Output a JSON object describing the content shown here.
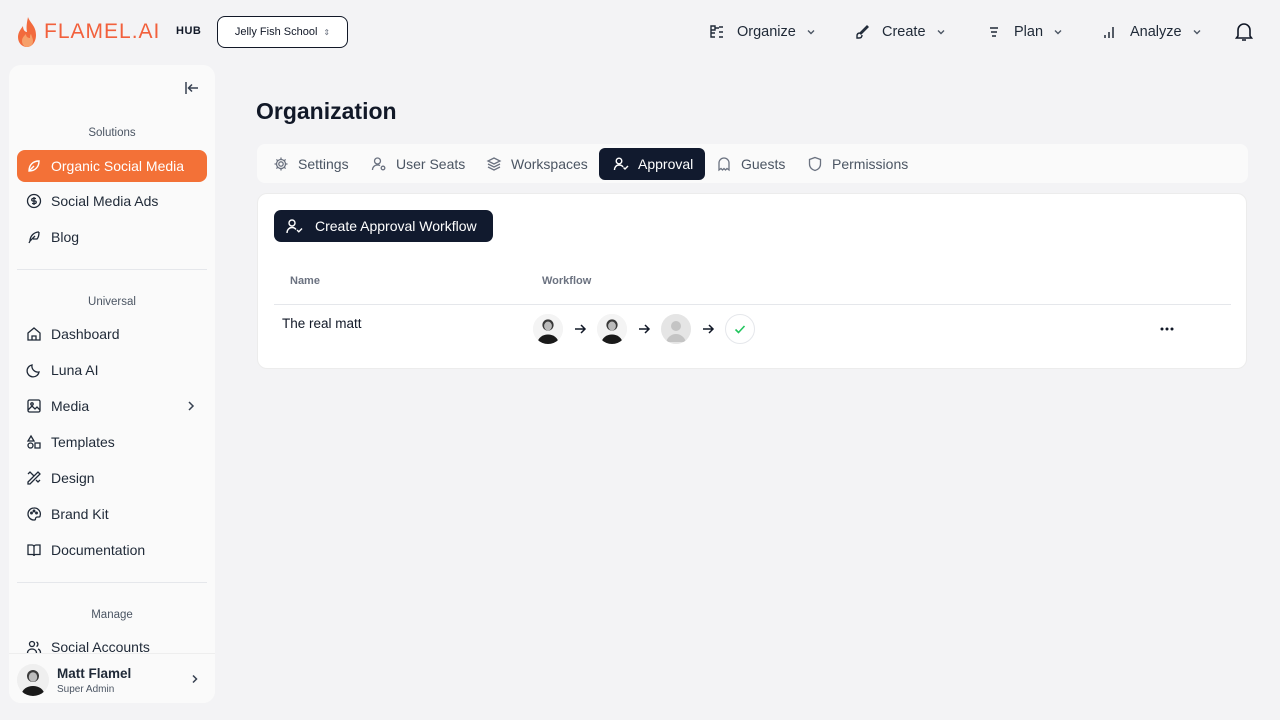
{
  "brand": {
    "name": "FLAMEL.AI",
    "hub": "HUB",
    "accent": "#f37137",
    "dark": "#111a2e"
  },
  "workspace_selector": {
    "value": "Jelly Fish School"
  },
  "topnav": [
    {
      "label": "Organize",
      "icon": "organize-icon"
    },
    {
      "label": "Create",
      "icon": "brush-icon"
    },
    {
      "label": "Plan",
      "icon": "plan-icon"
    },
    {
      "label": "Analyze",
      "icon": "bar-chart-icon"
    }
  ],
  "sidebar": {
    "sections": {
      "solutions": "Solutions",
      "universal": "Universal",
      "manage": "Manage"
    },
    "solutions": [
      {
        "label": "Organic Social Media",
        "icon": "leaf-icon",
        "active": true
      },
      {
        "label": "Social Media Ads",
        "icon": "dollar-icon"
      },
      {
        "label": "Blog",
        "icon": "feather-icon"
      }
    ],
    "universal": [
      {
        "label": "Dashboard",
        "icon": "home-icon"
      },
      {
        "label": "Luna AI",
        "icon": "moon-icon"
      },
      {
        "label": "Media",
        "icon": "image-icon"
      },
      {
        "label": "Templates",
        "icon": "shapes-icon"
      },
      {
        "label": "Design",
        "icon": "pen-ruler-icon"
      },
      {
        "label": "Brand Kit",
        "icon": "palette-icon"
      },
      {
        "label": "Documentation",
        "icon": "book-icon"
      }
    ],
    "manage": [
      {
        "label": "Social Accounts",
        "icon": "users-icon"
      }
    ],
    "user": {
      "name": "Matt Flamel",
      "role": "Super Admin"
    }
  },
  "page": {
    "title": "Organization",
    "tabs": [
      {
        "label": "Settings",
        "icon": "gear-icon"
      },
      {
        "label": "User Seats",
        "icon": "user-gear-icon"
      },
      {
        "label": "Workspaces",
        "icon": "layers-icon"
      },
      {
        "label": "Approval",
        "icon": "user-check-icon",
        "active": true
      },
      {
        "label": "Guests",
        "icon": "ghost-icon"
      },
      {
        "label": "Permissions",
        "icon": "shield-icon"
      }
    ]
  },
  "approval": {
    "create_button": "Create Approval Workflow",
    "columns": {
      "name": "Name",
      "workflow": "Workflow"
    },
    "rows": [
      {
        "name": "The real matt",
        "steps": [
          "approver-avatar",
          "approver-avatar",
          "placeholder-avatar",
          "approved-check"
        ]
      }
    ]
  }
}
